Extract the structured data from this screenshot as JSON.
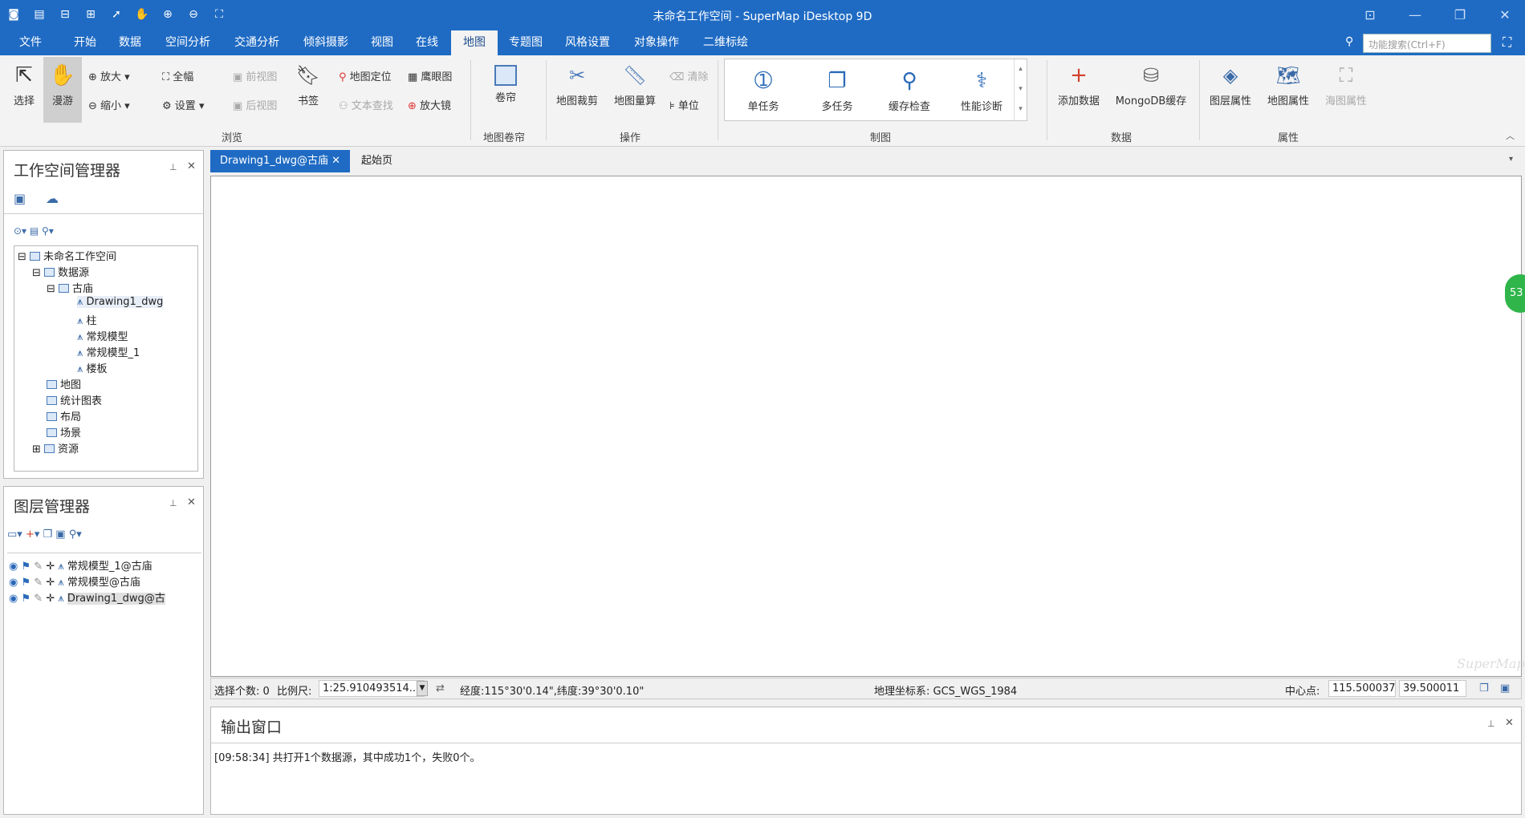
{
  "window": {
    "title": "未命名工作空间 - SuperMap iDesktop 9D"
  },
  "menubar": {
    "items": [
      "文件",
      "开始",
      "数据",
      "空间分析",
      "交通分析",
      "倾斜摄影",
      "视图",
      "在线",
      "地图",
      "专题图",
      "风格设置",
      "对象操作",
      "二维标绘"
    ],
    "active": "地图",
    "search_placeholder": "功能搜索(Ctrl+F)"
  },
  "ribbon": {
    "browse": {
      "label": "浏览",
      "select": "选择",
      "pan": "漫游",
      "zoom_in": "放大",
      "zoom_out": "缩小",
      "full": "全幅",
      "settings": "设置",
      "prev_view": "前视图",
      "next_view": "后视图",
      "bookmark": "书签",
      "locate": "地图定位",
      "text_find": "文本查找",
      "eagle_eye": "鹰眼图",
      "magnifier": "放大镜"
    },
    "swipe": {
      "label": "地图卷帘",
      "swipe": "卷帘"
    },
    "ops": {
      "label": "操作",
      "clip": "地图裁剪",
      "measure": "地图量算",
      "clear": "清除",
      "unit": "单位"
    },
    "cartography": {
      "label": "制图",
      "single_task": "单任务",
      "multi_task": "多任务",
      "cache_check": "缓存检查",
      "perf_diag": "性能诊断"
    },
    "data": {
      "label": "数据",
      "add_data": "添加数据",
      "mongodb": "MongoDB缓存"
    },
    "props": {
      "label": "属性",
      "layer_props": "图层属性",
      "map_props": "地图属性",
      "chart_props": "海图属性"
    }
  },
  "workspace": {
    "title": "工作空间管理器",
    "tree": {
      "root": "未命名工作空间",
      "datasources": "数据源",
      "ds_name": "古庙",
      "datasets": [
        "Drawing1_dwg",
        "柱",
        "常规模型",
        "常规模型_1",
        "楼板"
      ],
      "maps": "地图",
      "charts": "统计图表",
      "layouts": "布局",
      "scenes": "场景",
      "resources": "资源"
    }
  },
  "layers": {
    "title": "图层管理器",
    "items": [
      "常规模型_1@古庙",
      "常规模型@古庙",
      "Drawing1_dwg@古"
    ]
  },
  "tabs": {
    "active": "Drawing1_dwg@古庙",
    "other": "起始页"
  },
  "map": {
    "watermark": "SuperMap",
    "badge": "53"
  },
  "status": {
    "sel_label": "选择个数: 0",
    "scale_label": "比例尺:",
    "scale_value": "1:25.910493514...",
    "coords": "经度:115°30'0.14\",纬度:39°30'0.10\"",
    "crs": "地理坐标系: GCS_WGS_1984",
    "center_label": "中心点:",
    "center_x": "115.500037",
    "center_y": "39.500011"
  },
  "output": {
    "title": "输出窗口",
    "log": "[09:58:34] 共打开1个数据源，其中成功1个，失败0个。"
  }
}
